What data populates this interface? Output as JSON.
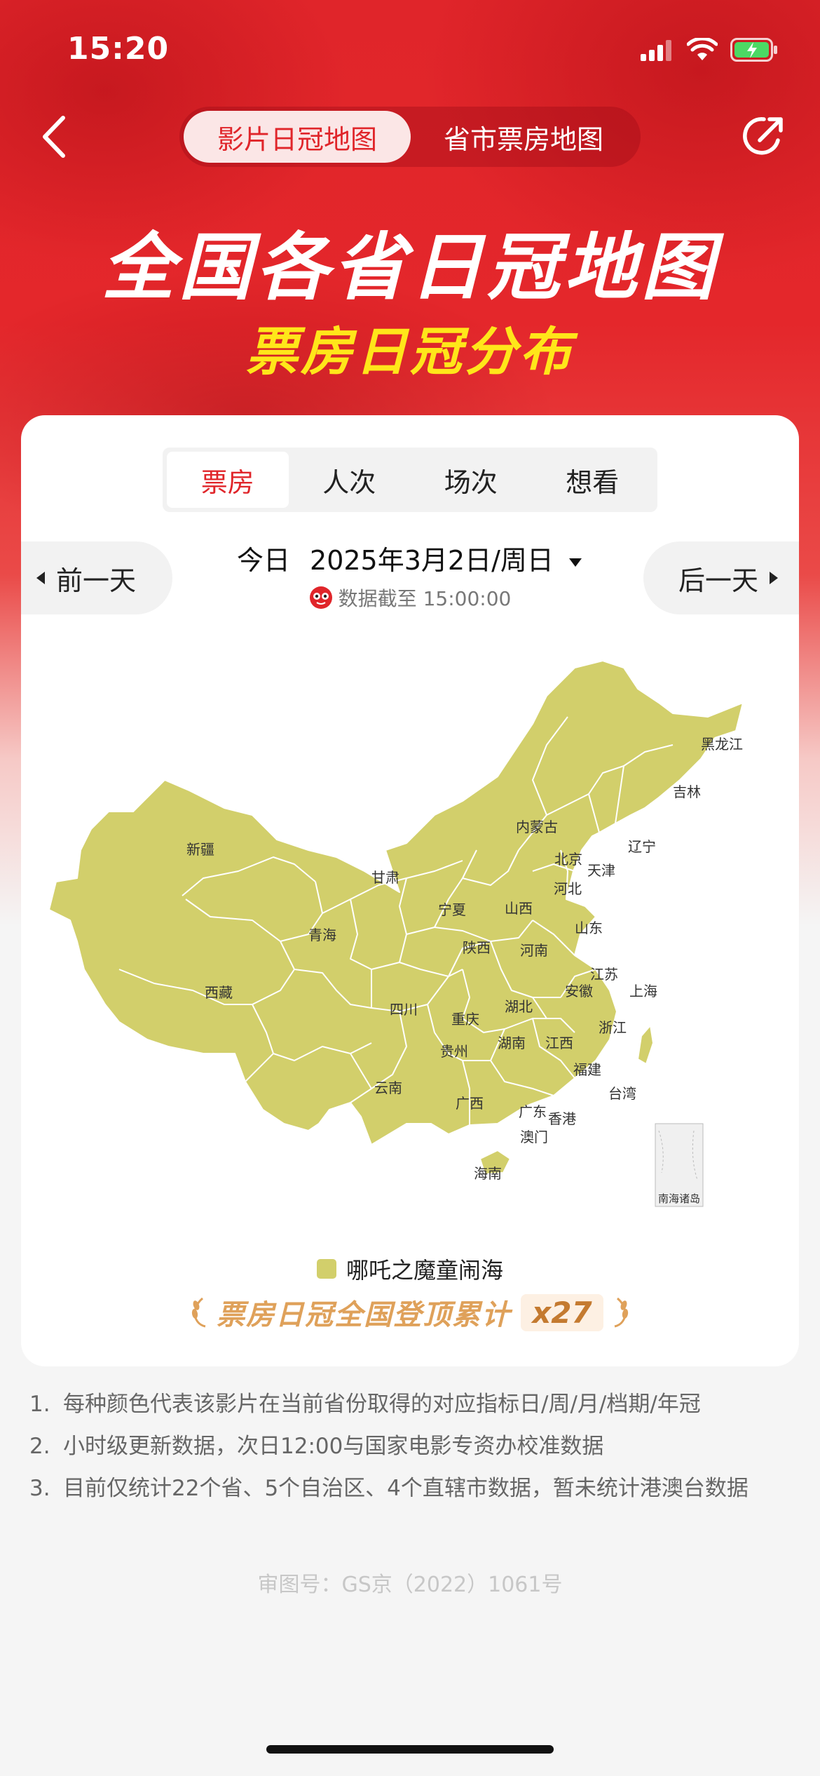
{
  "status_bar": {
    "time": "15:20"
  },
  "nav": {
    "tabs": [
      {
        "label": "影片日冠地图",
        "active": true
      },
      {
        "label": "省市票房地图",
        "active": false
      }
    ]
  },
  "hero": {
    "title": "全国各省日冠地图",
    "subtitle": "票房日冠分布"
  },
  "metric_tabs": [
    {
      "label": "票房",
      "active": true
    },
    {
      "label": "人次",
      "active": false
    },
    {
      "label": "场次",
      "active": false
    },
    {
      "label": "想看",
      "active": false
    }
  ],
  "date_bar": {
    "prev_label": "前一天",
    "next_label": "后一天",
    "today_label": "今日",
    "date": "2025年3月2日/周日",
    "update_text": "数据截至 15:00:00"
  },
  "map": {
    "fill_color": "#d2cf6b",
    "provinces": [
      "黑龙江",
      "吉林",
      "辽宁",
      "内蒙古",
      "北京",
      "天津",
      "河北",
      "山西",
      "山东",
      "新疆",
      "甘肃",
      "宁夏",
      "青海",
      "陕西",
      "河南",
      "江苏",
      "上海",
      "安徽",
      "西藏",
      "四川",
      "重庆",
      "湖北",
      "浙江",
      "贵州",
      "湖南",
      "江西",
      "福建",
      "台湾",
      "云南",
      "广西",
      "广东",
      "香港",
      "澳门",
      "海南"
    ],
    "inset_label": "南海诸岛"
  },
  "legend": {
    "label": "哪吒之魔童闹海",
    "color": "#d2cf6b"
  },
  "crown": {
    "text": "票房日冠全国登顶累计",
    "count": "x27"
  },
  "notes": [
    {
      "num": "1.",
      "text": "每种颜色代表该影片在当前省份取得的对应指标日/周/月/档期/年冠"
    },
    {
      "num": "2.",
      "text": "小时级更新数据，次日12:00与国家电影专资办校准数据"
    },
    {
      "num": "3.",
      "text": "目前仅统计22个省、5个自治区、4个直辖市数据，暂未统计港澳台数据"
    }
  ],
  "approval": "审图号：GS京（2022）1061号"
}
